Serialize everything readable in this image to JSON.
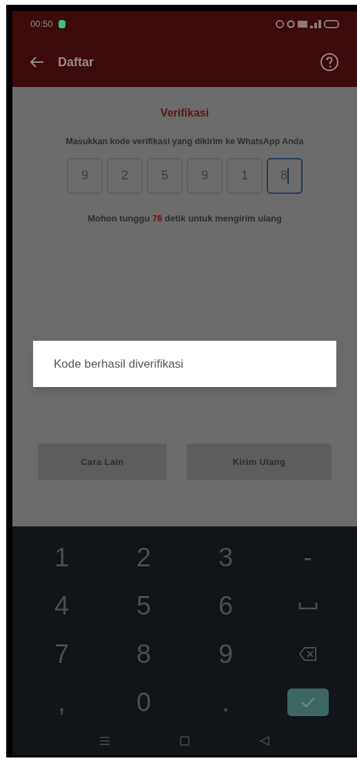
{
  "status_bar": {
    "time": "00:50"
  },
  "header": {
    "title": "Daftar"
  },
  "verification": {
    "title": "Verifikasi",
    "instruction": "Masukkan kode verifikasi yang dikirim ke WhatsApp Anda",
    "digits": [
      {
        "value": "9",
        "selected": false
      },
      {
        "value": "2",
        "selected": false
      },
      {
        "value": "5",
        "selected": false
      },
      {
        "value": "9",
        "selected": false
      },
      {
        "value": "1",
        "selected": false
      },
      {
        "value": "8",
        "selected": true
      }
    ],
    "countdown": {
      "before": "Mohon tunggu",
      "seconds": "76",
      "after": "detik untuk mengirim ulang"
    }
  },
  "toast": {
    "message": "Kode berhasil diverifikasi"
  },
  "buttons": [
    {
      "label": "Cara Lain",
      "disabled": true
    },
    {
      "label": "Kirim Ulang",
      "disabled": true
    }
  ],
  "keyboard": {
    "keys": [
      {
        "kind": "text",
        "label": "1"
      },
      {
        "kind": "text",
        "label": "2"
      },
      {
        "kind": "text",
        "label": "3"
      },
      {
        "kind": "text",
        "label": "-"
      },
      {
        "kind": "text",
        "label": "4"
      },
      {
        "kind": "text",
        "label": "5"
      },
      {
        "kind": "text",
        "label": "6"
      },
      {
        "kind": "space"
      },
      {
        "kind": "text",
        "label": "7"
      },
      {
        "kind": "text",
        "label": "8"
      },
      {
        "kind": "text",
        "label": "9"
      },
      {
        "kind": "backspace"
      },
      {
        "kind": "text",
        "label": ","
      },
      {
        "kind": "text",
        "label": "0"
      },
      {
        "kind": "text",
        "label": "."
      },
      {
        "kind": "done"
      }
    ]
  }
}
